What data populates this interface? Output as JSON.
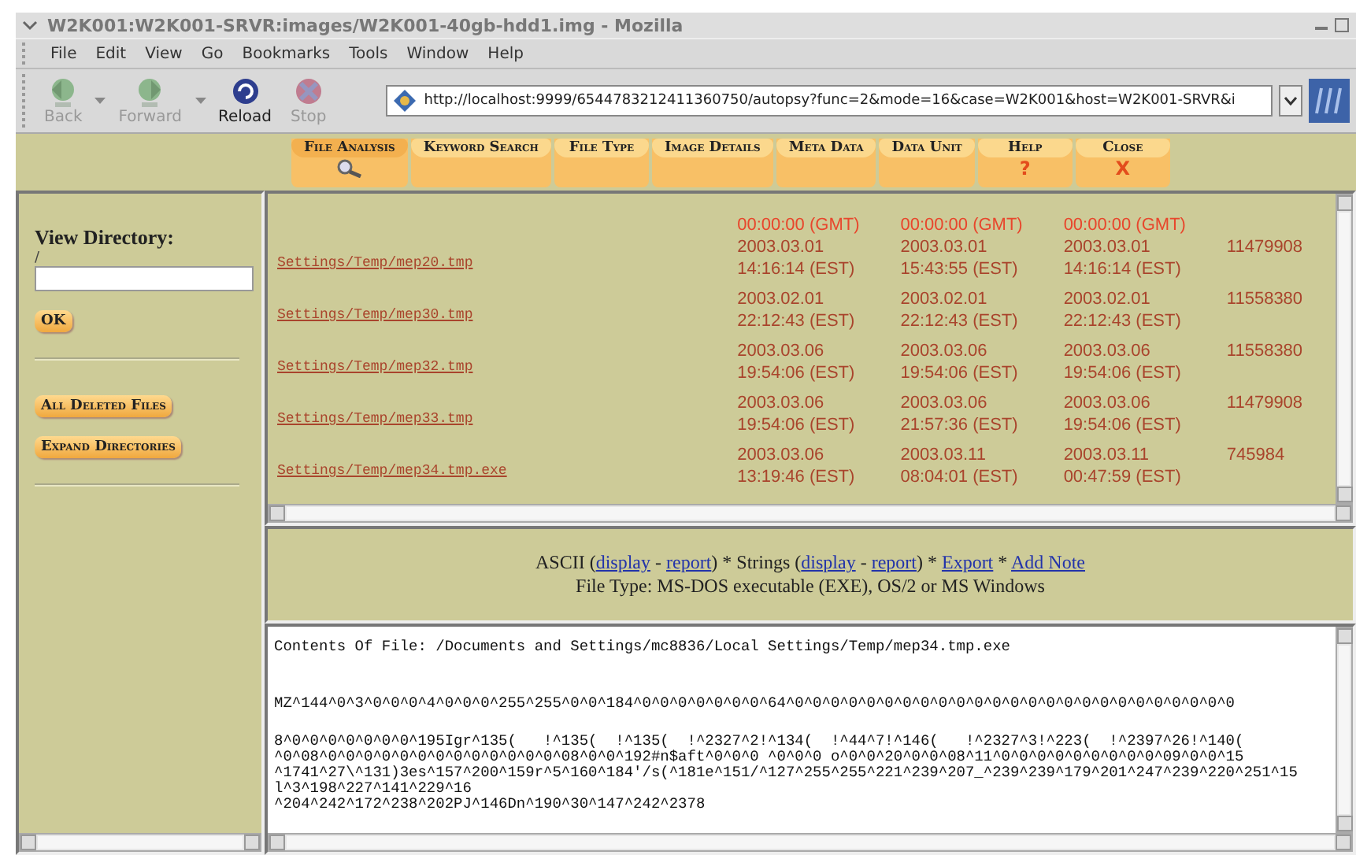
{
  "window": {
    "title": "W2K001:W2K001-SRVR:images/W2K001-40gb-hdd1.img - Mozilla"
  },
  "menu": [
    "File",
    "Edit",
    "View",
    "Go",
    "Bookmarks",
    "Tools",
    "Window",
    "Help"
  ],
  "toolbar": [
    {
      "label": "Back",
      "kind": "back",
      "disabled": true
    },
    {
      "label": "Forward",
      "kind": "forward",
      "disabled": true
    },
    {
      "label": "Reload",
      "kind": "reload",
      "disabled": false
    },
    {
      "label": "Stop",
      "kind": "stop",
      "disabled": true
    }
  ],
  "address": {
    "value": "http://localhost:9999/6544783212411360750/autopsy?func=2&mode=16&case=W2K001&host=W2K001-SRVR&i"
  },
  "tabs": [
    {
      "label": "File Analysis",
      "selected": true
    },
    {
      "label": "Keyword Search",
      "selected": false
    },
    {
      "label": "File Type",
      "selected": false
    },
    {
      "label": "Image Details",
      "selected": false
    },
    {
      "label": "Meta Data",
      "selected": false
    },
    {
      "label": "Data Unit",
      "selected": false
    },
    {
      "label": "Help",
      "selected": false,
      "glyph": "?"
    },
    {
      "label": "Close",
      "selected": false,
      "glyph": "X"
    }
  ],
  "sidebar": {
    "heading": "View Directory:",
    "path": "/",
    "ok_button": "OK",
    "buttons": [
      "All Deleted Files",
      "Expand Directories"
    ]
  },
  "file_list": {
    "rows": [
      {
        "times": [
          [
            "00:00:00 (GMT)"
          ],
          [
            "00:00:00 (GMT)"
          ],
          [
            "00:00:00 (GMT)"
          ]
        ],
        "color": "#e8462c"
      },
      {
        "name": "Settings/Temp/mep20.tmp",
        "times": [
          [
            "2003.03.01",
            "14:16:14 (EST)"
          ],
          [
            "2003.03.01",
            "15:43:55 (EST)"
          ],
          [
            "2003.03.01",
            "14:16:14 (EST)"
          ]
        ],
        "size": "11479908",
        "color": "#a9442c"
      },
      {
        "name": "Settings/Temp/mep30.tmp",
        "times": [
          [
            "2003.02.01",
            "22:12:43 (EST)"
          ],
          [
            "2003.02.01",
            "22:12:43 (EST)"
          ],
          [
            "2003.02.01",
            "22:12:43 (EST)"
          ]
        ],
        "size": "11558380",
        "color": "#a9442c"
      },
      {
        "name": "Settings/Temp/mep32.tmp",
        "times": [
          [
            "2003.03.06",
            "19:54:06 (EST)"
          ],
          [
            "2003.03.06",
            "19:54:06 (EST)"
          ],
          [
            "2003.03.06",
            "19:54:06 (EST)"
          ]
        ],
        "size": "11558380",
        "color": "#a9442c"
      },
      {
        "name": "Settings/Temp/mep33.tmp",
        "times": [
          [
            "2003.03.06",
            "19:54:06 (EST)"
          ],
          [
            "2003.03.06",
            "21:57:36 (EST)"
          ],
          [
            "2003.03.06",
            "19:54:06 (EST)"
          ]
        ],
        "size": "11479908",
        "color": "#a9442c"
      },
      {
        "name": "Settings/Temp/mep34.tmp.exe",
        "times": [
          [
            "2003.03.06",
            "13:19:46 (EST)"
          ],
          [
            "2003.03.11",
            "08:04:01 (EST)"
          ],
          [
            "2003.03.11",
            "00:47:59 (EST)"
          ]
        ],
        "size": "745984",
        "color": "#a9442c"
      }
    ]
  },
  "view_options": {
    "parts": [
      {
        "text": "ASCII (",
        "kind": "text"
      },
      {
        "text": "display",
        "kind": "link"
      },
      {
        "text": " - ",
        "kind": "text"
      },
      {
        "text": "report",
        "kind": "link"
      },
      {
        "text": ") * Strings (",
        "kind": "text"
      },
      {
        "text": "display",
        "kind": "link"
      },
      {
        "text": " - ",
        "kind": "text"
      },
      {
        "text": "report",
        "kind": "link"
      },
      {
        "text": ") * ",
        "kind": "text"
      },
      {
        "text": "Export",
        "kind": "link"
      },
      {
        "text": " * ",
        "kind": "text"
      },
      {
        "text": "Add Note",
        "kind": "link"
      }
    ],
    "file_type": "File Type: MS-DOS executable (EXE), OS/2 or MS Windows"
  },
  "contents": {
    "heading": "Contents Of File: /Documents and Settings/mc8836/Local Settings/Temp/mep34.tmp.exe",
    "first_line": "MZ^144^0^3^0^0^0^4^0^0^0^255^255^0^0^184^0^0^0^0^0^0^0^64^0^0^0^0^0^0^0^0^0^0^0^0^0^0^0^0^0^0^0^0^0^0^0^0^0",
    "lines": [
      "8^0^0^0^0^0^0^0^195Igr^135(   !^135(  !^135(  !^2327^2!^134(  !^44^7!^146(   !^2327^3!^223(  !^2397^26!^140(",
      "^0^08^0^0^0^0^0^0^0^0^0^0^0^0^0^08^0^0^192#n$aft^0^0^0 ^0^0^0 o^0^0^20^0^0^08^11^0^0^0^0^0^0^0^0^0^09^0^0^15",
      "^1741^27\\^131)3es^157^200^159r^5^160^184'/s(^181e^151/^127^255^255^221^239^207_^239^239^179^201^247^239^220^251^15",
      "l^3^198^227^141^229^16",
      "^204^242^172^238^202PJ^146Dn^190^30^147^242^2378"
    ]
  }
}
